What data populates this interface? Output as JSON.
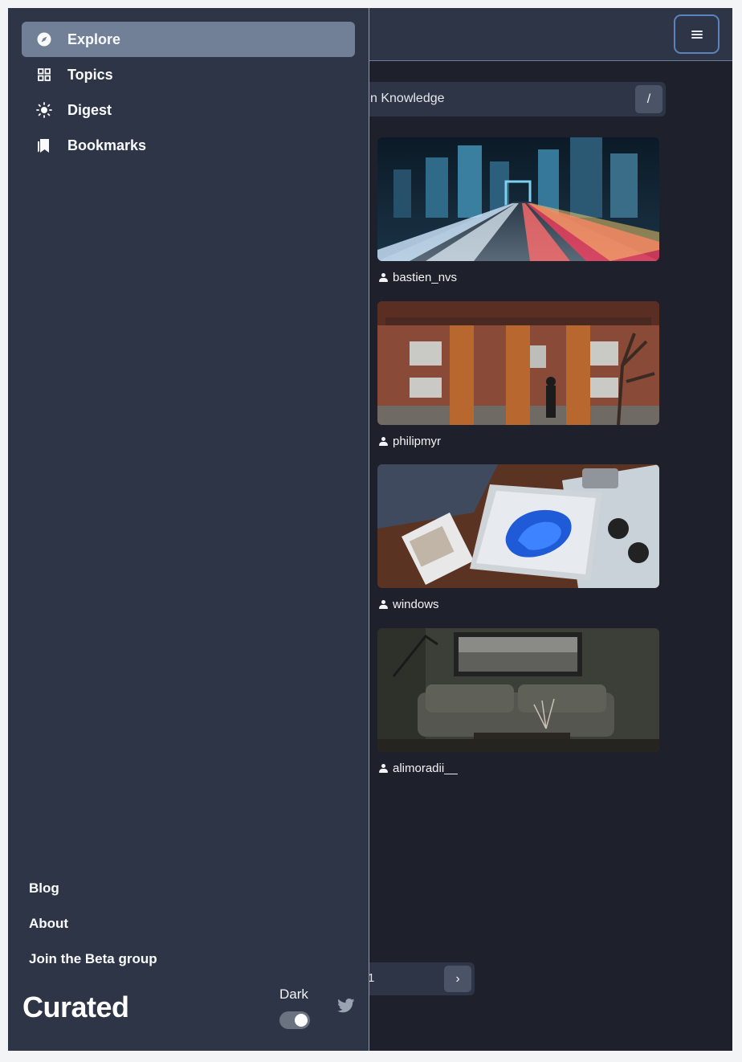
{
  "nav": {
    "items": [
      {
        "label": "Explore",
        "icon": "compass-icon",
        "active": true
      },
      {
        "label": "Topics",
        "icon": "grid-icon",
        "active": false
      },
      {
        "label": "Digest",
        "icon": "sun-icon",
        "active": false
      },
      {
        "label": "Bookmarks",
        "icon": "bookmarks-icon",
        "active": false
      }
    ]
  },
  "footer": {
    "links": [
      "Blog",
      "About",
      "Join the Beta group"
    ],
    "brand": "Curated",
    "theme_label": "Dark",
    "theme_dark_on": true,
    "social_icon": "twitter-icon"
  },
  "search": {
    "placeholder": "n Knowledge",
    "shortcut": "/"
  },
  "cards": [
    {
      "author": "bastien_nvs",
      "image": "city-light-trails-night"
    },
    {
      "author": "philipmyr",
      "image": "brick-building-columns-walker"
    },
    {
      "author": "windows",
      "image": "tablet-on-map-flatlay"
    },
    {
      "author": "alimoradii__",
      "image": "dark-living-room-sofa"
    }
  ],
  "pagination": {
    "page": "1",
    "next": "›"
  },
  "colors": {
    "drawer_bg": "#2e3546",
    "content_bg": "#1e212c",
    "active_item": "#718096",
    "focus_ring": "#5a84bb"
  }
}
